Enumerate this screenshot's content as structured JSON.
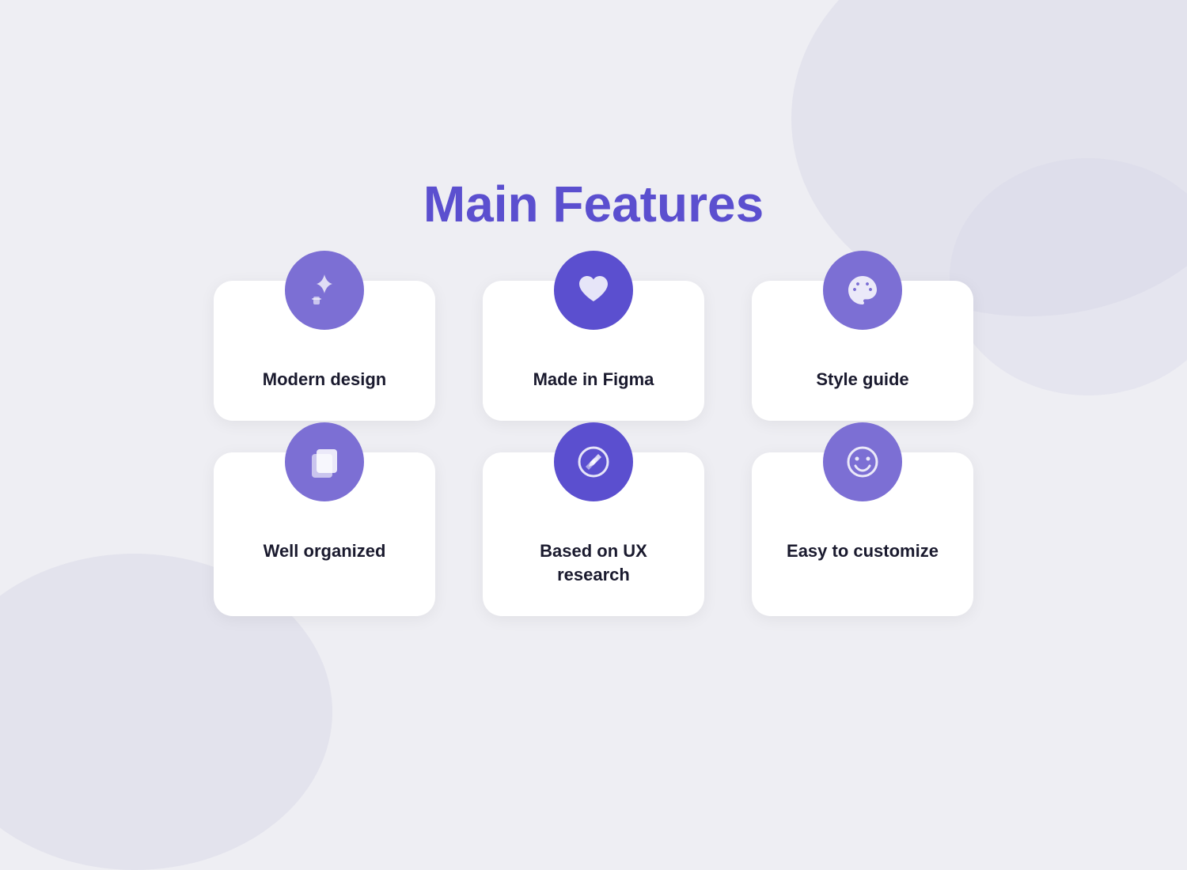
{
  "page": {
    "title": "Main Features",
    "background_color": "#eeeef3",
    "title_color": "#5b4fcf"
  },
  "features": [
    {
      "id": "modern-design",
      "label": "Modern design",
      "icon": "sparkle",
      "icon_style": "purple-medium"
    },
    {
      "id": "made-in-figma",
      "label": "Made in Figma",
      "icon": "heart",
      "icon_style": "purple-dark"
    },
    {
      "id": "style-guide",
      "label": "Style guide",
      "icon": "palette",
      "icon_style": "purple-medium"
    },
    {
      "id": "well-organized",
      "label": "Well organized",
      "icon": "copy",
      "icon_style": "purple-medium"
    },
    {
      "id": "based-on-ux",
      "label": "Based  on UX\nresearch",
      "icon": "compass",
      "icon_style": "purple-dark"
    },
    {
      "id": "easy-to-customize",
      "label": "Easy to customize",
      "icon": "smiley",
      "icon_style": "purple-medium"
    }
  ]
}
